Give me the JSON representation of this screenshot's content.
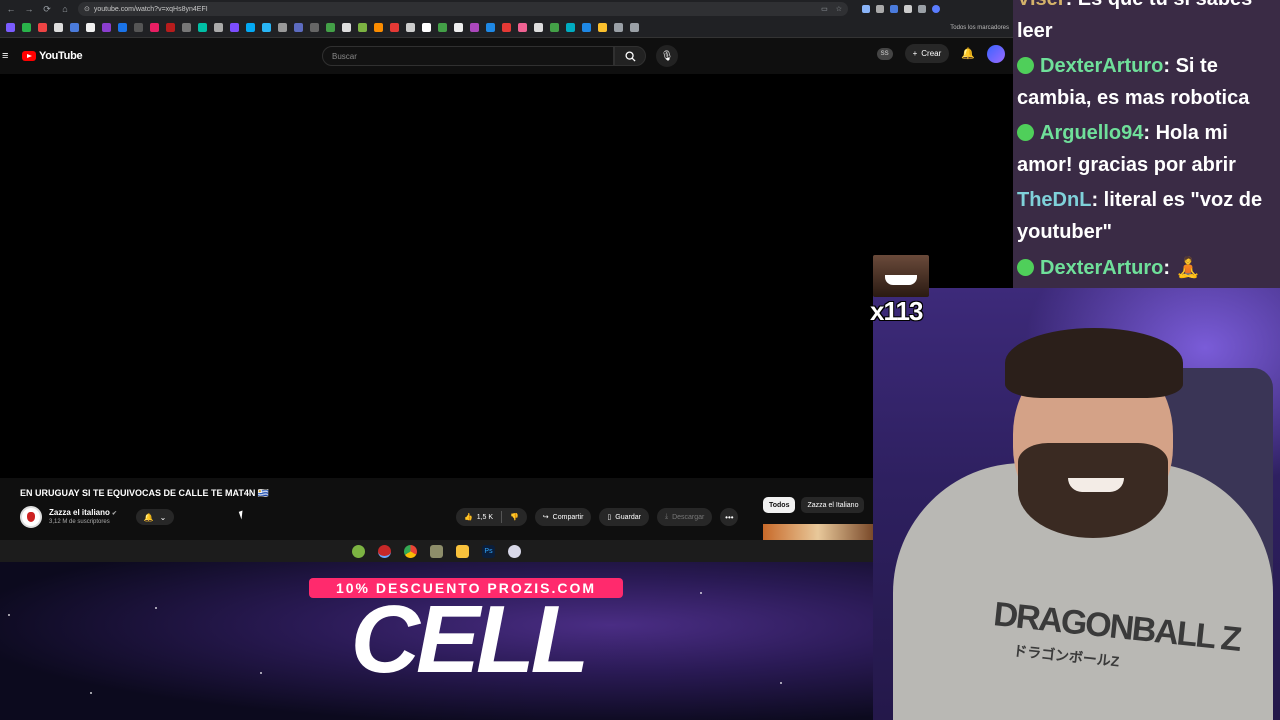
{
  "browser": {
    "url": "youtube.com/watch?v=xqHs8yn4EFI",
    "bookmarks_all_label": "Todos los marcadores"
  },
  "youtube": {
    "logo_text": "YouTube",
    "search_placeholder": "Buscar",
    "ss_badge": "SS",
    "create_label": "Crear"
  },
  "video": {
    "title": "EN URUGUAY SI TE EQUIVOCAS DE CALLE TE MAT4N 🇺🇾",
    "channel_name": "Zazza el italiano",
    "channel_subs": "3,12 M de suscriptores",
    "likes": "1,5 K",
    "share_label": "Compartir",
    "save_label": "Guardar",
    "download_label": "Descargar"
  },
  "related_chips": [
    "Todos",
    "Zazza el Italiano"
  ],
  "promo": {
    "band_text": "10% DESCUENTO PROZIS.COM",
    "big_text": "CELL"
  },
  "chat": [
    {
      "user": "Viser",
      "text": ": Es que tu si sabes leer",
      "badge": false
    },
    {
      "user": "DexterArturo",
      "text": ": Si te cambia, es mas robotica",
      "badge": true
    },
    {
      "user": "Arguello94",
      "text": ": Hola mi amor! gracias por abrir",
      "badge": true
    },
    {
      "user": "TheDnL",
      "text": ": literal es \"voz de youtuber\"",
      "badge": false
    },
    {
      "user": "DexterArturo",
      "text": ": 🧘",
      "badge": true
    }
  ],
  "emote": {
    "count": "x113"
  },
  "webcam": {
    "shirt_logo": "DRAGONBALL Z",
    "shirt_logo_sub": "ドラゴンボールZ"
  },
  "colors": {
    "youtube_red": "#ff0000",
    "chat_username": "#6fe09a",
    "promo_pink": "#ff2a6d",
    "chat_bg": "#3a2b45"
  }
}
